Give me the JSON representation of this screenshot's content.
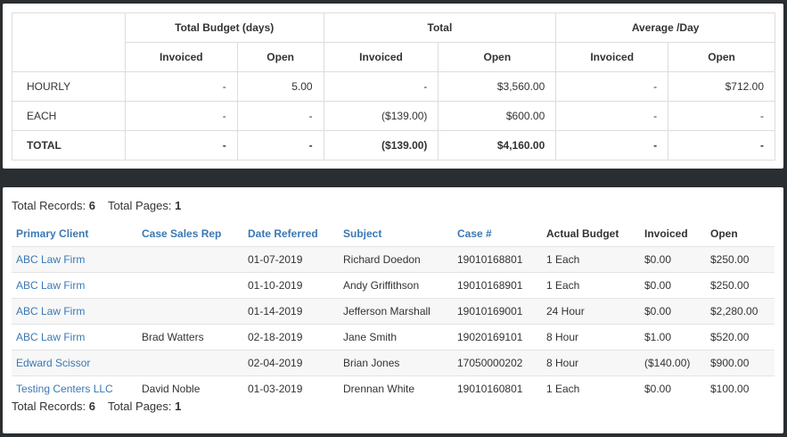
{
  "summary": {
    "groups": [
      "Total Budget (days)",
      "Total",
      "Average /Day"
    ],
    "subheaders": [
      "Invoiced",
      "Open",
      "Invoiced",
      "Open",
      "Invoiced",
      "Open"
    ],
    "rows": [
      {
        "label": "HOURLY",
        "values": [
          "-",
          "5.00",
          "-",
          "$3,560.00",
          "-",
          "$712.00"
        ]
      },
      {
        "label": "EACH",
        "values": [
          "-",
          "-",
          "($139.00)",
          "$600.00",
          "-",
          "-"
        ]
      },
      {
        "label": "TOTAL",
        "values": [
          "-",
          "-",
          "($139.00)",
          "$4,160.00",
          "-",
          "-"
        ]
      }
    ]
  },
  "records": {
    "total_records_label": "Total Records:",
    "total_records": "6",
    "total_pages_label": "Total Pages:",
    "total_pages": "1",
    "columns": [
      "Primary Client",
      "Case Sales Rep",
      "Date Referred",
      "Subject",
      "Case #",
      "Actual Budget",
      "Invoiced",
      "Open"
    ],
    "rows": [
      [
        "ABC Law Firm",
        "",
        "01-07-2019",
        "Richard Doedon",
        "19010168801",
        "1 Each",
        "$0.00",
        "$250.00"
      ],
      [
        "ABC Law Firm",
        "",
        "01-10-2019",
        "Andy Griffithson",
        "19010168901",
        "1 Each",
        "$0.00",
        "$250.00"
      ],
      [
        "ABC Law Firm",
        "",
        "01-14-2019",
        "Jefferson Marshall",
        "19010169001",
        "24 Hour",
        "$0.00",
        "$2,280.00"
      ],
      [
        "ABC Law Firm",
        "Brad Watters",
        "02-18-2019",
        "Jane Smith",
        "19020169101",
        "8 Hour",
        "$1.00",
        "$520.00"
      ],
      [
        "Edward Scissor",
        "",
        "02-04-2019",
        "Brian Jones",
        "17050000202",
        "8 Hour",
        "($140.00)",
        "$900.00"
      ],
      [
        "Testing Centers LLC",
        "David Noble",
        "01-03-2019",
        "Drennan White",
        "19010160801",
        "1 Each",
        "$0.00",
        "$100.00"
      ]
    ]
  }
}
